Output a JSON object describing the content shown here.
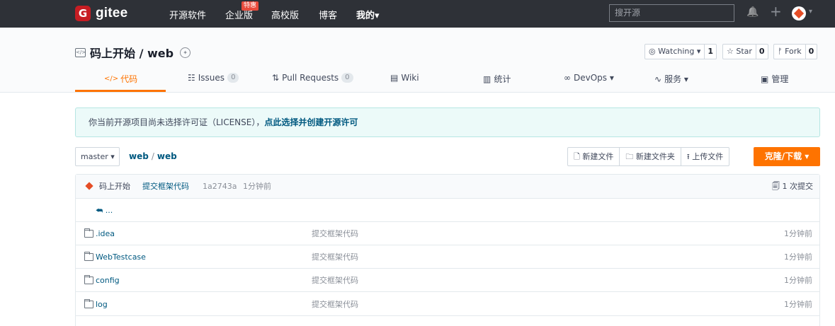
{
  "topbar": {
    "logo_glyph": "G",
    "logo_text": "gitee",
    "nav": [
      "开源软件",
      "企业版",
      "高校版",
      "博客",
      "我的"
    ],
    "nav_badge": "特惠",
    "search_placeholder": "搜开源",
    "dropdown_caret": "▾",
    "bell_icon": "🔔",
    "plus_icon": "+"
  },
  "repo": {
    "icon_glyph": "</>",
    "title": "码上开始 / web",
    "watching_label": "◎ Watching ▾",
    "watching_count": "1",
    "star_label": "☆ Star",
    "star_count": "0",
    "fork_label": "ᚠ Fork",
    "fork_count": "0"
  },
  "tabs": [
    {
      "icon": "</>",
      "label": "代码",
      "count": ""
    },
    {
      "icon": "☷",
      "label": "Issues",
      "count": "0"
    },
    {
      "icon": "⇅",
      "label": "Pull Requests",
      "count": "0"
    },
    {
      "icon": "▤",
      "label": "Wiki",
      "count": ""
    },
    {
      "icon": "▥",
      "label": "统计",
      "count": ""
    },
    {
      "icon": "∞",
      "label": "DevOps ▾",
      "count": ""
    },
    {
      "icon": "∿",
      "label": "服务 ▾",
      "count": ""
    },
    {
      "icon": "▣",
      "label": "管理",
      "count": ""
    }
  ],
  "notice": {
    "text": "你当前开源项目尚未选择许可证（LICENSE），",
    "link": "点此选择并创建开源许可"
  },
  "toolbar": {
    "branch": "master ▾",
    "path_root": "web",
    "path_sep": "/",
    "path_leaf": "web",
    "new_file": "🗋 新建文件",
    "new_folder": "🗀 新建文件夹",
    "upload": "⭱ 上传文件",
    "clone": "克隆/下载 ▾"
  },
  "commit": {
    "author": "码上开始",
    "message": "提交框架代码",
    "hash": "1a2743a",
    "time": "1分钟前",
    "count_label": "🗐 1 次提交"
  },
  "up_label": "⮪ ...",
  "files": [
    {
      "name": ".idea",
      "message": "提交框架代码",
      "time": "1分钟前"
    },
    {
      "name": "WebTestcase",
      "message": "提交框架代码",
      "time": "1分钟前"
    },
    {
      "name": "config",
      "message": "提交框架代码",
      "time": "1分钟前"
    },
    {
      "name": "log",
      "message": "提交框架代码",
      "time": "1分钟前"
    }
  ],
  "colors": {
    "navbar": "#2e3137",
    "brand": "#c71d23",
    "accent_orange": "#fe7300",
    "link_blue": "#005980",
    "notice_bg": "#ecfaf9"
  }
}
